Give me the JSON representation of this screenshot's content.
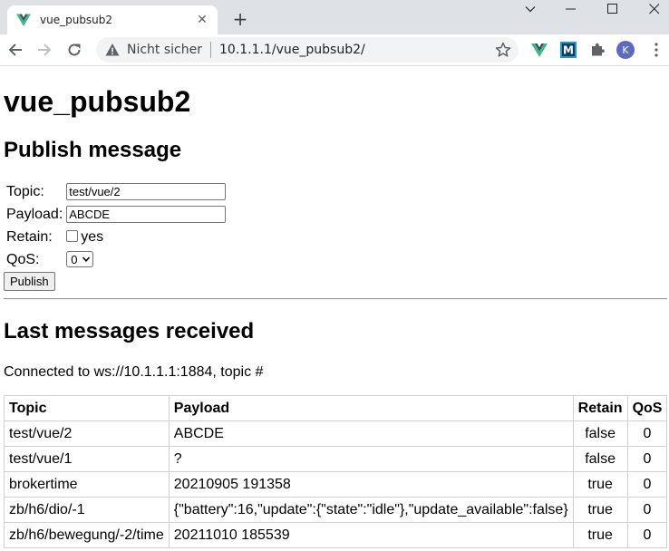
{
  "browser": {
    "tab_title": "vue_pubsub2",
    "tab_close": "✕",
    "new_tab": "+",
    "security_label": "Nicht sicher",
    "url": "10.1.1.1/vue_pubsub2/",
    "avatar_letter": "K",
    "colors": {
      "vue_green": "#41b883",
      "vue_dark": "#34495e",
      "ext_teal": "#1a9ad1"
    }
  },
  "page": {
    "title": "vue_pubsub2",
    "publish": {
      "heading": "Publish message",
      "topic_label": "Topic:",
      "topic_value": "test/vue/2",
      "payload_label": "Payload:",
      "payload_value": "ABCDE",
      "retain_label": "Retain:",
      "retain_option": "yes",
      "qos_label": "QoS:",
      "qos_value": "0",
      "publish_button": "Publish"
    },
    "received": {
      "heading": "Last messages received",
      "status": "Connected to ws://10.1.1.1:1884, topic #",
      "columns": [
        "Topic",
        "Payload",
        "Retain",
        "QoS"
      ],
      "rows": [
        [
          "test/vue/2",
          "ABCDE",
          "false",
          "0"
        ],
        [
          "test/vue/1",
          "?",
          "false",
          "0"
        ],
        [
          "brokertime",
          "20210905 191358",
          "true",
          "0"
        ],
        [
          "zb/h6/dio/-1",
          "{\"battery\":16,\"update\":{\"state\":\"idle\"},\"update_available\":false}",
          "true",
          "0"
        ],
        [
          "zb/h6/bewegung/-2/time",
          "20211010 185539",
          "true",
          "0"
        ]
      ]
    }
  }
}
